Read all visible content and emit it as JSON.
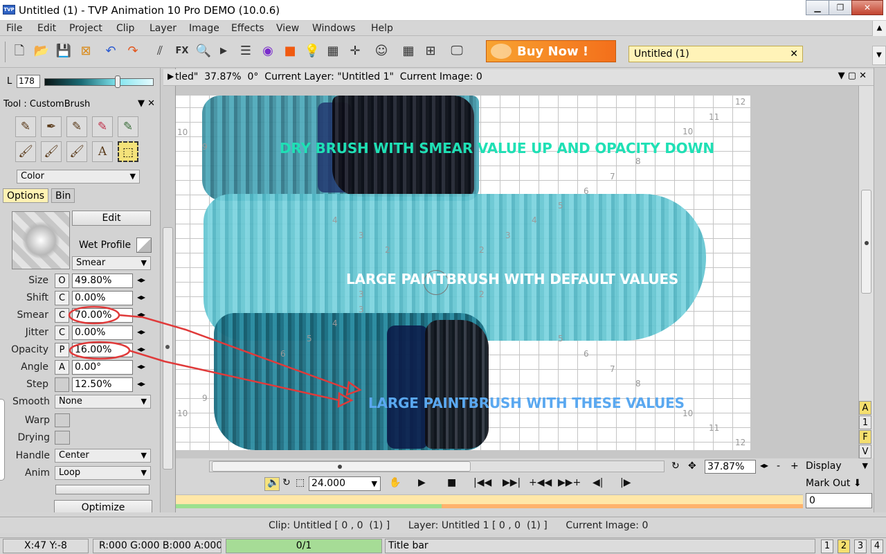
{
  "window": {
    "title": "Untitled (1) - TVP Animation 10 Pro DEMO (10.0.6)",
    "app_icon": "TVP"
  },
  "menu": [
    "File",
    "Edit",
    "Project",
    "Clip",
    "Layer",
    "Image",
    "Effects",
    "View",
    "Windows",
    "Help"
  ],
  "toolbar": {
    "fx_label": "FX",
    "buy_now": "Buy Now !",
    "project_tab": "Untitled (1)",
    "project_tab_close": "✕"
  },
  "color": {
    "channel": "L",
    "value": "178"
  },
  "tool": {
    "header": "Tool : CustomBrush",
    "color_mode": "Color",
    "brush_glyph": "A"
  },
  "tabs": {
    "options": "Options",
    "bin": "Bin"
  },
  "options": {
    "edit_label": "Edit",
    "wet_profile_label": "Wet Profile",
    "mode": "Smear",
    "params": [
      {
        "label": "Size",
        "key": "O",
        "value": "49.80%"
      },
      {
        "label": "Shift",
        "key": "C",
        "value": "0.00%"
      },
      {
        "label": "Smear",
        "key": "C",
        "value": "70.00%"
      },
      {
        "label": "Jitter",
        "key": "C",
        "value": "0.00%"
      },
      {
        "label": "Opacity",
        "key": "P",
        "value": "16.00%"
      },
      {
        "label": "Angle",
        "key": "A",
        "value": "0.00°"
      },
      {
        "label": "Step",
        "key": "",
        "value": "12.50%"
      }
    ],
    "smooth_label": "Smooth",
    "smooth_value": "None",
    "warp_label": "Warp",
    "drying_label": "Drying",
    "handle_label": "Handle",
    "handle_value": "Center",
    "anim_label": "Anim",
    "anim_value": "Loop",
    "optimize_label": "Optimize"
  },
  "canvas": {
    "header": "tled\"  37.87%  0°  Current Layer: \"Untitled 1\"  Current Image: 0",
    "annotation_top": "DRY BRUSH  WITH SMEAR  VALUE UP AND OPACITY DOWN",
    "annotation_mid": "LARGE PAINTBRUSH WITH DEFAULT VALUES",
    "annotation_bottom": "LARGE PAINTBRUSH WITH THESE VALUES",
    "annotation_colors": {
      "top": "#1fe0b5",
      "mid": "#ffffff",
      "bottom": "#5aa8f0",
      "circle": "#e03a3a"
    },
    "grid_numbers": [
      "12",
      "11",
      "10",
      "10",
      "9",
      "8",
      "7",
      "6",
      "5",
      "4",
      "4",
      "3",
      "3",
      "2",
      "2",
      "3",
      "2",
      "4",
      "3",
      "5",
      "5",
      "6",
      "6",
      "7",
      "8",
      "9",
      "10",
      "10",
      "11",
      "12"
    ]
  },
  "side_badges": [
    "A",
    "1",
    "F",
    "V"
  ],
  "zoom": {
    "value": "37.87%",
    "minus": "-",
    "plus": "+",
    "display": "Display"
  },
  "transport": {
    "fps": "24.000",
    "mark_out": "Mark Out",
    "mark_value": "0"
  },
  "status": {
    "line1": "Clip: Untitled [ 0 , 0  (1) ]      Layer: Untitled 1 [ 0 , 0  (1) ]      Current Image: 0",
    "coords": "X:47  Y:-8",
    "rgba": "R:000 G:000 B:000 A:000",
    "progress": "0/1",
    "hint": "Title bar",
    "pages": [
      "1",
      "2",
      "3",
      "4"
    ]
  }
}
